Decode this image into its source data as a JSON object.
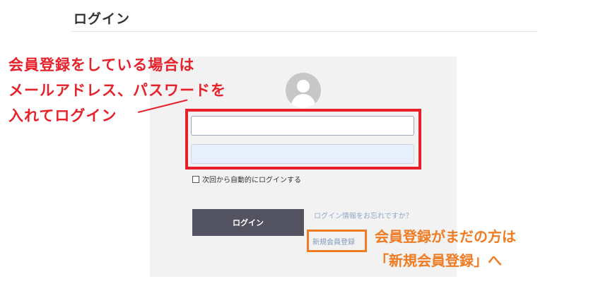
{
  "header": {
    "title": "ログイン"
  },
  "form": {
    "email_placeholder": "",
    "password_placeholder": "",
    "remember_label": "次回から自動的にログインする",
    "login_button": "ログイン",
    "forgot_link": "ログイン情報をお忘れですか？",
    "signup_link": "新規会員登録"
  },
  "annotations": {
    "red_lines": [
      "会員登録をしている場合は",
      "メールアドレス、パスワードを",
      "入れてログイン"
    ],
    "orange_lines": [
      "会員登録がまだの方は",
      "「新規会員登録」へ"
    ]
  },
  "colors": {
    "annotation_red": "#e8202a",
    "annotation_orange": "#f07b22",
    "button_bg": "#535260",
    "link": "#8ea9c8"
  },
  "icons": {
    "avatar": "user-avatar-icon"
  }
}
